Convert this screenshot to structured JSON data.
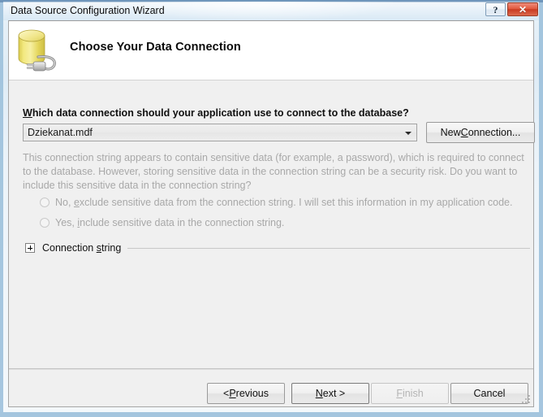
{
  "window": {
    "title": "Data Source Configuration Wizard",
    "help_button_label": "?",
    "close_button_label": "✕"
  },
  "header": {
    "page_title": "Choose Your Data Connection",
    "icon_name": "database-connection-icon"
  },
  "main": {
    "question_prefix": "W",
    "question_label": "hich data connection should your application use to connect to the database?",
    "question_full": "Which data connection should your application use to connect to the database?",
    "connection_combo": {
      "value": "Dziekanat.mdf",
      "placeholder": "Dziekanat.mdf"
    },
    "new_connection_button": {
      "prefix": "New ",
      "accel": "C",
      "suffix": "onnection...",
      "full": "New Connection..."
    },
    "sensitive_paragraph": "This connection string appears to contain sensitive data (for example, a password), which is required to connect to the database. However, storing sensitive data in the connection string can be a security risk. Do you want to include this sensitive data in the connection string?",
    "radios": [
      {
        "prefix": "No, ",
        "accel": "e",
        "suffix": "xclude sensitive data from the connection string. I will set this information in my application code.",
        "full": "No, exclude sensitive data from the connection string. I will set this information in my application code.",
        "checked": false,
        "enabled": false
      },
      {
        "prefix": "Yes, ",
        "accel": "i",
        "suffix": "nclude sensitive data in the connection string.",
        "full": "Yes, include sensitive data in the connection string.",
        "checked": false,
        "enabled": false
      }
    ],
    "expander": {
      "toggle_symbol": "+",
      "prefix": "Connection ",
      "accel": "s",
      "suffix": "tring",
      "full": "Connection string",
      "expanded": false
    }
  },
  "footer": {
    "previous": {
      "prefix": "< ",
      "accel": "P",
      "suffix": "revious",
      "full": "< Previous"
    },
    "next": {
      "prefix": "",
      "accel": "N",
      "suffix": "ext >",
      "full": "Next >"
    },
    "finish": {
      "prefix": "",
      "accel": "F",
      "suffix": "inish",
      "full": "Finish",
      "enabled": false
    },
    "cancel": {
      "prefix": "",
      "accel": "",
      "suffix": "Cancel",
      "full": "Cancel"
    }
  },
  "colors": {
    "accent_close": "#c93b22",
    "window_frame": "#98bdd9",
    "client_background": "#f0f0f0",
    "header_background": "#ffffff",
    "disabled_text": "#a8a8a8",
    "icon_database": "#e8dd6a"
  }
}
